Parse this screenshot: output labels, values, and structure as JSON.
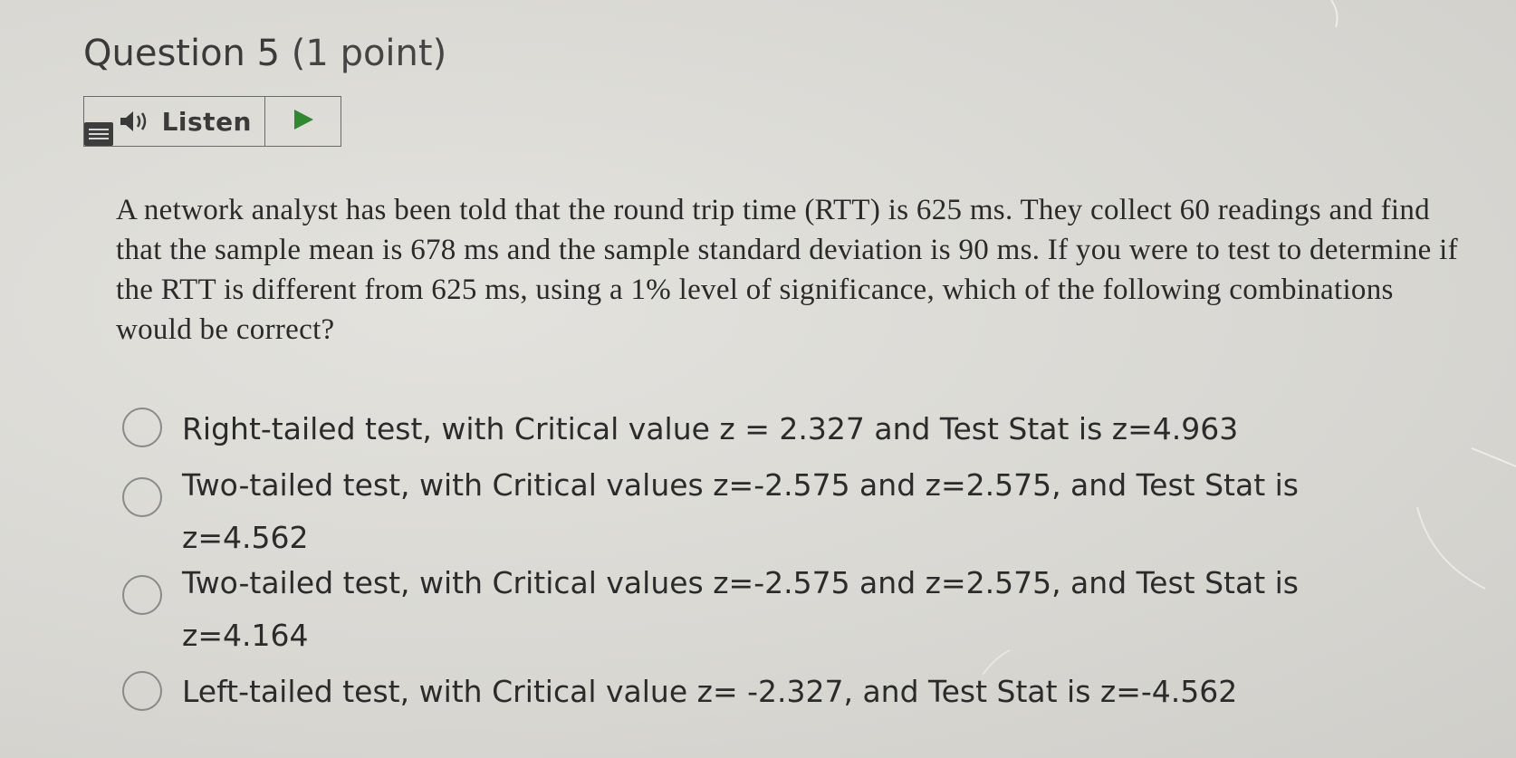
{
  "question": {
    "number_label": "Question 5",
    "points_label": "(1 point)"
  },
  "listen": {
    "label": "Listen"
  },
  "question_text": "A network analyst has been told that the round trip time (RTT) is 625 ms.  They collect 60 readings and find that the sample mean is 678 ms and the sample standard deviation is 90 ms. If you were to test to determine if the RTT is different from 625 ms,  using a 1% level of significance, which of the following combinations would be correct?",
  "options": [
    {
      "label": "Right-tailed test, with Critical value z = 2.327 and Test Stat is z=4.963"
    },
    {
      "label": "Two-tailed test, with Critical values  z=-2.575 and z=2.575, and Test Stat is z=4.562"
    },
    {
      "label": "Two-tailed test, with Critical values  z=-2.575 and z=2.575, and Test Stat is z=4.164"
    },
    {
      "label": "Left-tailed test, with Critical value z= -2.327, and Test Stat is z=-4.562"
    }
  ],
  "colors": {
    "background": "#dcdbd6",
    "text": "#2b2b2b",
    "border": "#6b6b6b",
    "play_icon": "#2f8a2f"
  },
  "icons": {
    "menu": "menu-icon",
    "speaker": "speaker-icon",
    "play": "play-icon"
  }
}
